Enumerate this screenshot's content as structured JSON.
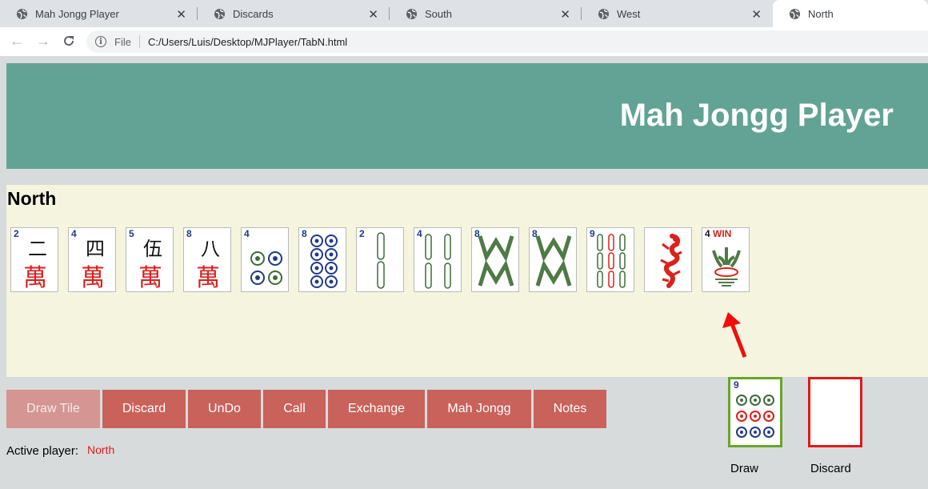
{
  "browser": {
    "tabs": [
      {
        "title": "Mah Jongg Player",
        "active": false
      },
      {
        "title": "Discards",
        "active": false
      },
      {
        "title": "South",
        "active": false
      },
      {
        "title": "West",
        "active": false
      },
      {
        "title": "North",
        "active": true
      }
    ],
    "url_scheme_label": "File",
    "url": "C:/Users/Luis/Desktop/MJPlayer/TabN.html"
  },
  "page": {
    "title": "Mah Jongg Player",
    "player_name": "North",
    "tiles": [
      {
        "number": "2",
        "suit": "characters",
        "glyph": "二"
      },
      {
        "number": "4",
        "suit": "characters",
        "glyph": "四"
      },
      {
        "number": "5",
        "suit": "characters",
        "glyph": "伍"
      },
      {
        "number": "8",
        "suit": "characters",
        "glyph": "八"
      },
      {
        "number": "4",
        "suit": "dots"
      },
      {
        "number": "8",
        "suit": "dots"
      },
      {
        "number": "2",
        "suit": "bamboo"
      },
      {
        "number": "4",
        "suit": "bamboo"
      },
      {
        "number": "8",
        "suit": "bamboo"
      },
      {
        "number": "8",
        "suit": "bamboo"
      },
      {
        "number": "9",
        "suit": "bamboo"
      },
      {
        "number": "",
        "suit": "dragon",
        "icon": "red-dragon-icon"
      },
      {
        "number": "4",
        "suit": "flower",
        "badge": "WIN",
        "icon": "flower-icon"
      }
    ],
    "buttons": {
      "draw_tile": "Draw Tile",
      "discard": "Discard",
      "undo": "UnDo",
      "call": "Call",
      "exchange": "Exchange",
      "mah_jongg": "Mah Jongg",
      "notes": "Notes"
    },
    "active_player_label": "Active player:",
    "active_player": "North",
    "draw_label": "Draw",
    "discard_label": "Discard",
    "draw_tile": {
      "number": "9",
      "suit": "dots"
    }
  },
  "colors": {
    "banner": "#63a395",
    "panel": "#f5f5df",
    "button": "#c9625b",
    "draw_border": "#6aa52a",
    "discard_border": "#e01a1a"
  }
}
